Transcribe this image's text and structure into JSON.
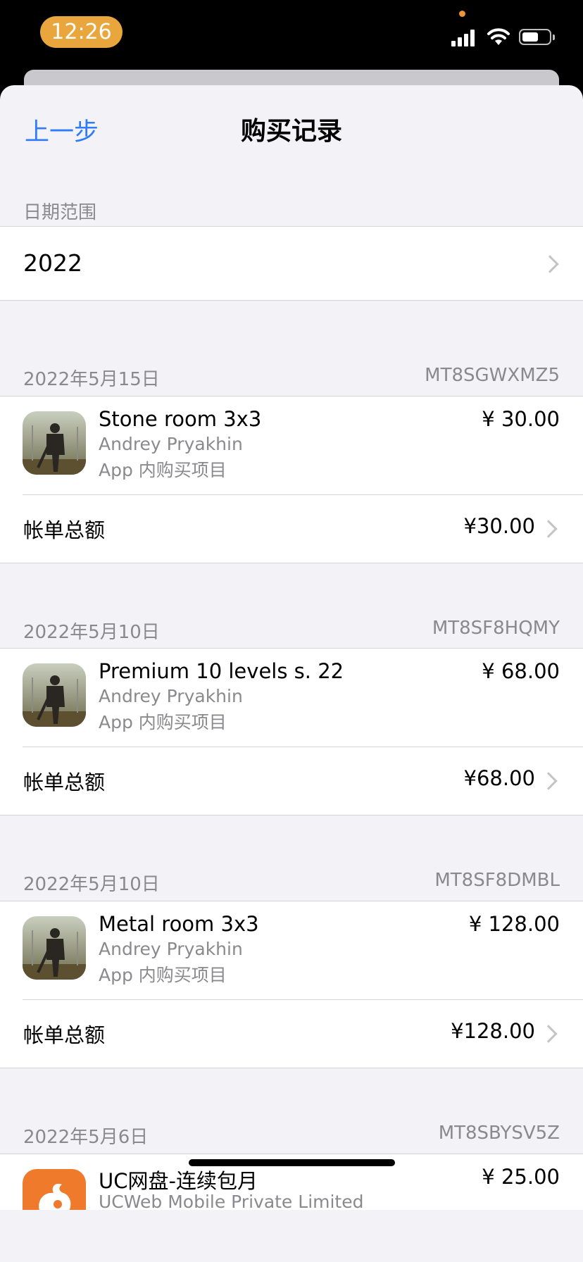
{
  "status_bar": {
    "time": "12:26"
  },
  "nav": {
    "back_label": "上一步",
    "title": "购买记录"
  },
  "date_range": {
    "section_label": "日期范围",
    "value": "2022"
  },
  "purchases": [
    {
      "date": "2022年5月15日",
      "order_id": "MT8SGWXMZ5",
      "item_name": "Stone room 3x3",
      "developer": "Andrey Pryakhin",
      "item_type": "App 内购买项目",
      "price": "¥ 30.00",
      "total_label": "帐单总额",
      "total_value": "¥30.00",
      "icon": "survival-game-icon"
    },
    {
      "date": "2022年5月10日",
      "order_id": "MT8SF8HQMY",
      "item_name": "Premium 10 levels s. 22",
      "developer": "Andrey Pryakhin",
      "item_type": "App 内购买项目",
      "price": "¥ 68.00",
      "total_label": "帐单总额",
      "total_value": "¥68.00",
      "icon": "survival-game-icon"
    },
    {
      "date": "2022年5月10日",
      "order_id": "MT8SF8DMBL",
      "item_name": "Metal room 3x3",
      "developer": "Andrey Pryakhin",
      "item_type": "App 内购买项目",
      "price": "¥ 128.00",
      "total_label": "帐单总额",
      "total_value": "¥128.00",
      "icon": "survival-game-icon"
    },
    {
      "date": "2022年5月6日",
      "order_id": "MT8SBYSV5Z",
      "item_name": "UC网盘-连续包月",
      "developer": "UCWeb Mobile Private Limited",
      "price": "¥ 25.00",
      "icon": "uc-squirrel-icon"
    }
  ],
  "colors": {
    "accent": "#2f7cf6",
    "time_pill": "#e9a63d",
    "uc_orange": "#f07a2b"
  }
}
